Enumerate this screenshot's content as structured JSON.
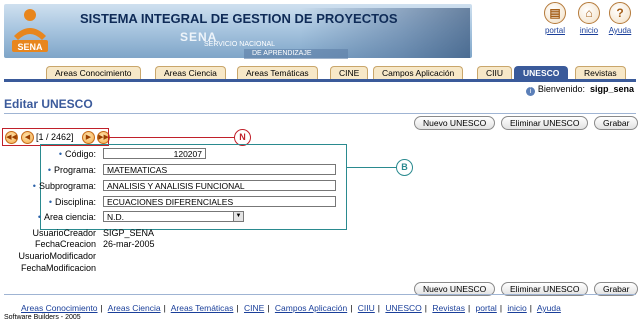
{
  "banner": {
    "title": "SISTEMA INTEGRAL DE GESTION DE PROYECTOS",
    "logo_text": "SENA",
    "sena_word": "SENA",
    "sena_line1": "SERVICIO NACIONAL",
    "sena_line2": "DE APRENDIZAJE",
    "global_buttons": [
      {
        "label": "portal",
        "icon": "book-icon",
        "glyph": "▤"
      },
      {
        "label": "inicio",
        "icon": "house-icon",
        "glyph": "⌂"
      },
      {
        "label": "Ayuda",
        "icon": "help-icon",
        "glyph": "?"
      }
    ]
  },
  "tabs": [
    {
      "label": "Areas Conocimiento"
    },
    {
      "label": "Areas Ciencia"
    },
    {
      "label": "Areas Temáticas"
    },
    {
      "label": "CINE"
    },
    {
      "label": "Campos Aplicación"
    },
    {
      "label": "CIIU"
    },
    {
      "label": "UNESCO",
      "active": true
    },
    {
      "label": "Revistas"
    }
  ],
  "welcome": {
    "label": "Bienvenido:",
    "user": "sigp_sena"
  },
  "page_title": "Editar UNESCO",
  "actions": {
    "new": "Nuevo UNESCO",
    "delete": "Eliminar UNESCO",
    "save": "Grabar"
  },
  "navigation": {
    "counter": "[1 / 2462]"
  },
  "annotations": {
    "nav_marker": "N",
    "form_marker": "B"
  },
  "form": {
    "codigo": {
      "label": "Código:",
      "value": "120207"
    },
    "programa": {
      "label": "Programa:",
      "value": "MATEMATICAS"
    },
    "subprograma": {
      "label": "Subprograma:",
      "value": "ANALISIS Y ANALISIS FUNCIONAL"
    },
    "disciplina": {
      "label": "Disciplina:",
      "value": "ECUACIONES DIFERENCIALES"
    },
    "area_ciencia": {
      "label": "Area ciencia:",
      "value": "N.D."
    }
  },
  "audit": {
    "usuario_creador": {
      "label": "UsuarioCreador",
      "value": "SIGP_SENA"
    },
    "fecha_creacion": {
      "label": "FechaCreacion",
      "value": "26-mar-2005"
    },
    "usuario_modificador": {
      "label": "UsuarioModificador",
      "value": ""
    },
    "fecha_modificacion": {
      "label": "FechaModificacion",
      "value": ""
    }
  },
  "footer": {
    "links": [
      "Areas Conocimiento",
      "Areas Ciencia",
      "Areas Temáticas",
      "CINE",
      "Campos Aplicación",
      "CIIU",
      "UNESCO",
      "Revistas",
      "portal",
      "inicio",
      "Ayuda"
    ],
    "copyright": "Software Builders - 2005"
  },
  "colors": {
    "accent": "#3a5a9a",
    "tab_bg": "#f7e8c8",
    "annotation_red": "#c0202a",
    "annotation_teal": "#2a8a8f"
  }
}
